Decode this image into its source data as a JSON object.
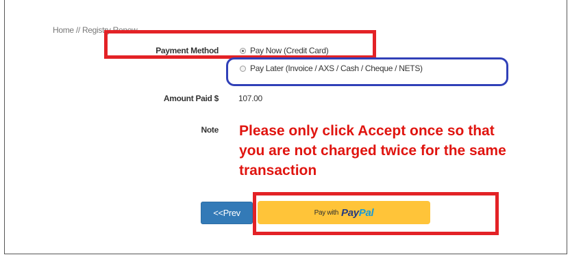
{
  "breadcrumb": "Home // Registry Renew",
  "payment": {
    "label": "Payment Method",
    "options": [
      {
        "label": "Pay Now (Credit Card)",
        "selected": true
      },
      {
        "label": "Pay Later (Invoice / AXS / Cash / Cheque / NETS)",
        "selected": false
      }
    ]
  },
  "amount": {
    "label": "Amount Paid $",
    "value": "107.00"
  },
  "note": {
    "label": "Note",
    "text": "Please only click Accept once so that\nyou are not charged twice for the same\ntransaction"
  },
  "buttons": {
    "prev_label": "<<Prev",
    "paypal_prefix": "Pay with",
    "paypal_pay": "Pay",
    "paypal_pal": "Pal"
  },
  "colors": {
    "note": "#e0140f",
    "prev_button": "#337ab7",
    "paypal_button": "#ffc439",
    "highlight_red": "#e32226",
    "highlight_blue": "#3040b8"
  }
}
